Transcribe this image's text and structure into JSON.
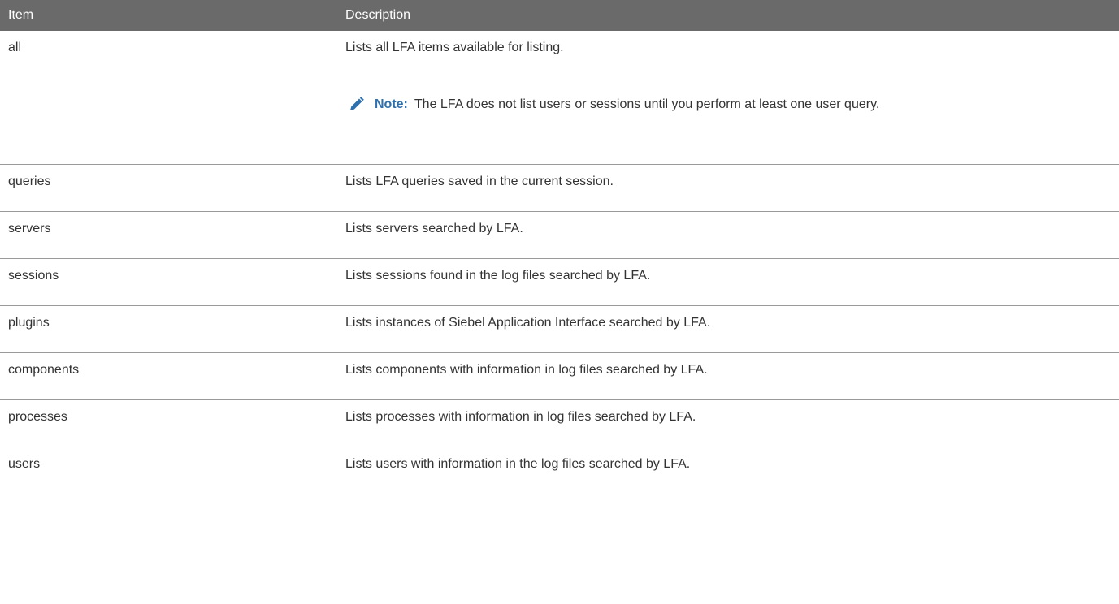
{
  "table": {
    "headers": [
      "Item",
      "Description"
    ],
    "rows": [
      {
        "item": "all",
        "description": "Lists all LFA items available for listing."
      },
      {
        "item": "queries",
        "description": "Lists LFA queries saved in the current session."
      },
      {
        "item": "servers",
        "description": "Lists servers searched by LFA."
      },
      {
        "item": "sessions",
        "description": "Lists sessions found in the log files searched by LFA."
      },
      {
        "item": "plugins",
        "description": "Lists instances of Siebel Application Interface searched by LFA."
      },
      {
        "item": "components",
        "description": "Lists components with information in log files searched by LFA."
      },
      {
        "item": "processes",
        "description": "Lists processes with information in log files searched by LFA."
      },
      {
        "item": "users",
        "description": "Lists users with information in the log files searched by LFA."
      }
    ]
  },
  "note": {
    "label": "Note:",
    "text": "The LFA does not list users or sessions until you perform at least one user query.",
    "icon": "pencil-icon"
  },
  "colors": {
    "header_bg": "#6a6a6a",
    "note_accent": "#2e6fae",
    "divider": "#9a9a9a"
  }
}
